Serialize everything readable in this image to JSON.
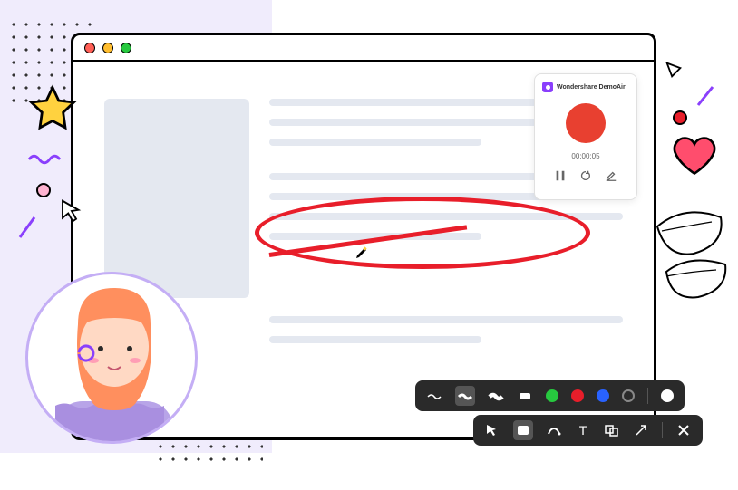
{
  "window": {
    "traffic_colors": [
      "#ff5f56",
      "#ffbd2e",
      "#27c93f"
    ]
  },
  "recorder": {
    "brand": "Wondershare DemoAir",
    "timer": "00:00:05"
  },
  "toolbar_brush": {
    "colors": {
      "green": "#27c93f",
      "red": "#e81e2a",
      "blue": "#2962ff"
    }
  }
}
